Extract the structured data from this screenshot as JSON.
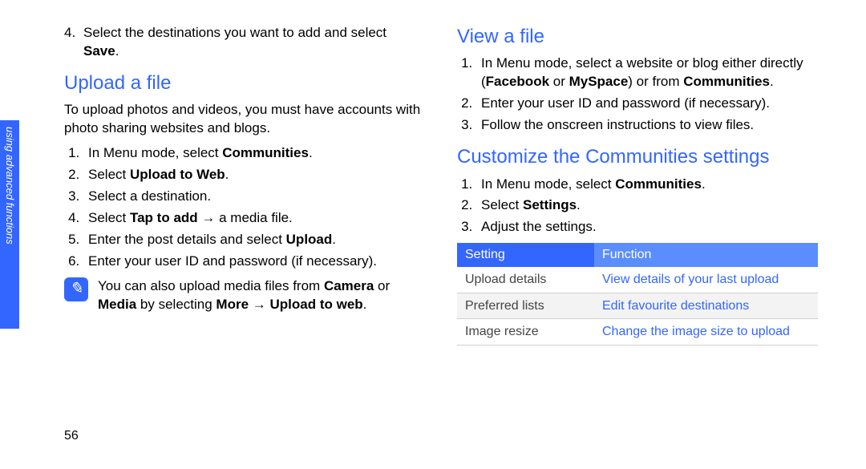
{
  "sideTab": "using advanced functions",
  "pageNumber": "56",
  "left": {
    "continued": {
      "number": "4.",
      "pre": "Select the destinations you want to add and select ",
      "bold1": "Save",
      "post": "."
    },
    "uploadHeading": "Upload a file",
    "uploadIntro": "To upload photos and videos, you must have accounts with photo sharing websites and blogs.",
    "steps": {
      "s1": {
        "pre": "In Menu mode, select ",
        "b1": "Communities",
        "post": "."
      },
      "s2": {
        "pre": "Select ",
        "b1": "Upload to Web",
        "post": "."
      },
      "s3": {
        "text": "Select a destination."
      },
      "s4": {
        "pre": "Select ",
        "b1": "Tap to add",
        "mid": " → a media file."
      },
      "s5": {
        "pre": "Enter the post details and select ",
        "b1": "Upload",
        "post": "."
      },
      "s6": {
        "text": "Enter your user ID and password (if necessary)."
      }
    },
    "note": {
      "iconLabel": "note-icon",
      "iconGlyph": "✎",
      "pre": "You can also upload media files from ",
      "b1": "Camera",
      "mid1": " or ",
      "b2": "Media",
      "mid2": " by selecting ",
      "b3": "More",
      "mid3": " → ",
      "b4": "Upload to web",
      "post": "."
    }
  },
  "right": {
    "viewHeading": "View a file",
    "viewSteps": {
      "s1": {
        "pre": "In Menu mode, select a website or blog either directly (",
        "b1": "Facebook",
        "mid1": " or ",
        "b2": "MySpace",
        "mid2": ") or from ",
        "b3": "Communities",
        "post": "."
      },
      "s2": {
        "text": "Enter your user ID and password (if necessary)."
      },
      "s3": {
        "text": "Follow the onscreen instructions to view files."
      }
    },
    "customizeHeading": "Customize the Communities settings",
    "customizeSteps": {
      "s1": {
        "pre": "In Menu mode, select ",
        "b1": "Communities",
        "post": "."
      },
      "s2": {
        "pre": "Select ",
        "b1": "Settings",
        "post": "."
      },
      "s3": {
        "text": "Adjust the settings."
      }
    },
    "table": {
      "headers": {
        "c1": "Setting",
        "c2": "Function"
      },
      "rows": [
        {
          "c1": "Upload details",
          "c2": "View details of your last upload"
        },
        {
          "c1": "Preferred lists",
          "c2": "Edit favourite destinations"
        },
        {
          "c1": "Image resize",
          "c2": "Change the image size to upload"
        }
      ]
    }
  }
}
